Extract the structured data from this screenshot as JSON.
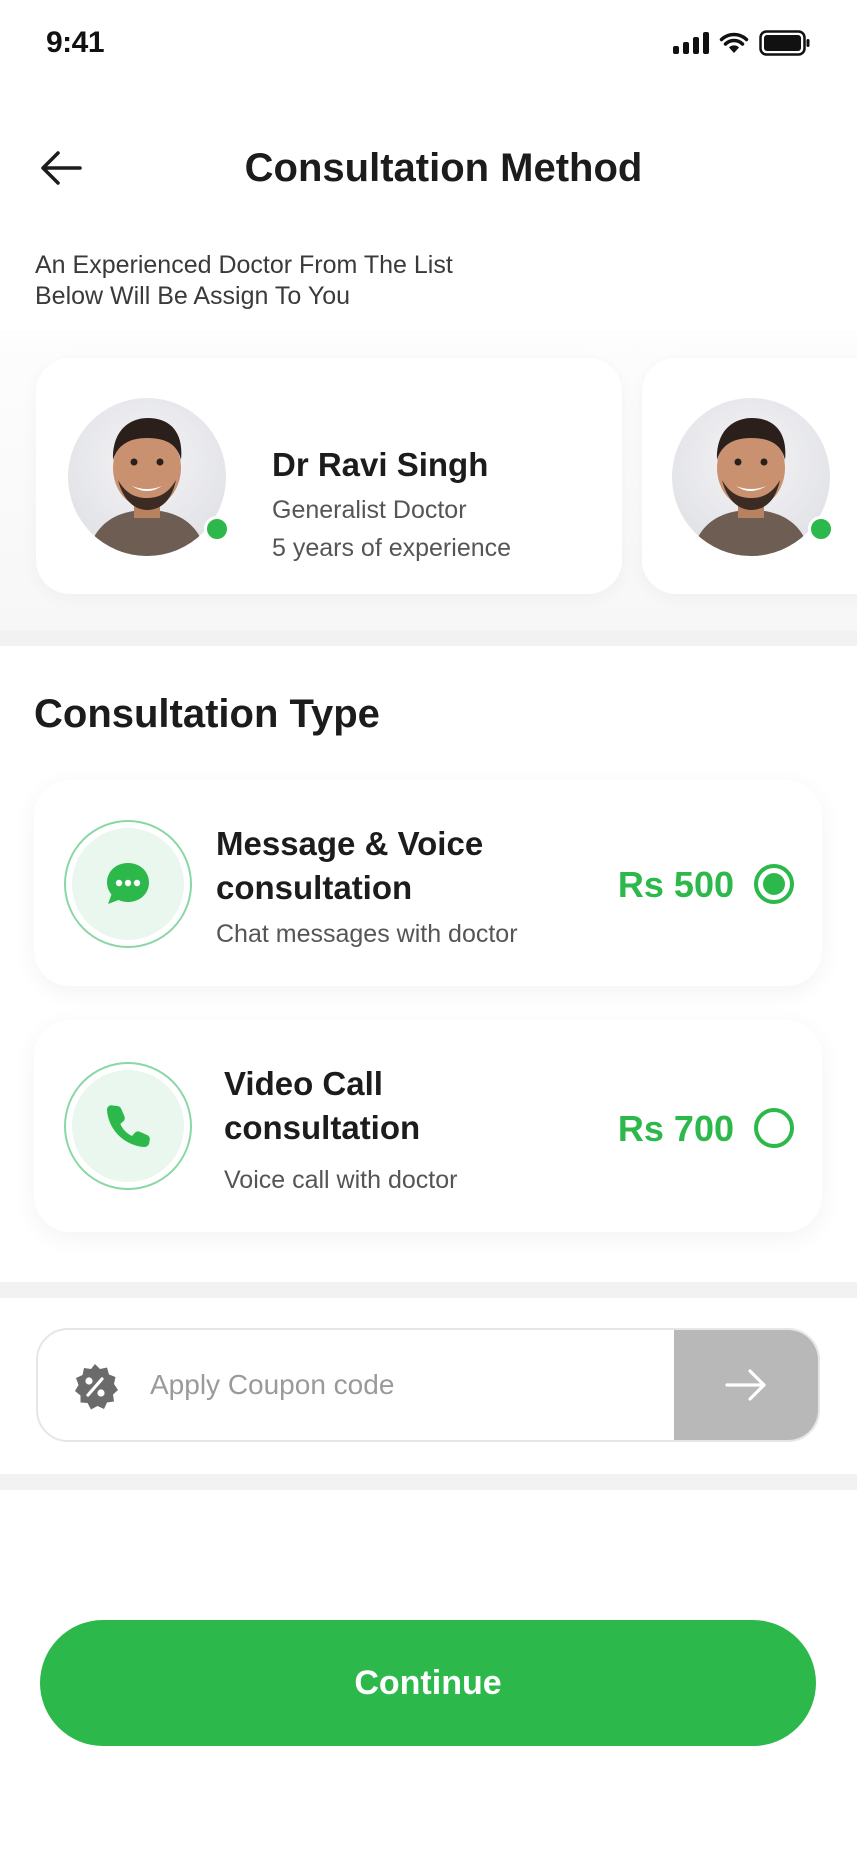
{
  "status_bar": {
    "time": "9:41"
  },
  "header": {
    "title": "Consultation Method"
  },
  "subtitle": "An Experienced Doctor From The List Below Will Be Assign To You",
  "doctors": [
    {
      "name": "Dr Ravi Singh",
      "specialty": "Generalist Doctor",
      "experience": "5 years of experience",
      "online": true
    },
    {
      "name": "",
      "specialty": "",
      "experience": "",
      "online": true
    }
  ],
  "consultation": {
    "section_title": "Consultation Type",
    "types": [
      {
        "title": "Message & Voice consultation",
        "description": "Chat messages with doctor",
        "price": "Rs 500",
        "icon": "chat-icon",
        "selected": true
      },
      {
        "title": "Video Call consultation",
        "description": "Voice call with doctor",
        "price": "Rs 700",
        "icon": "phone-icon",
        "selected": false
      }
    ]
  },
  "coupon": {
    "placeholder": "Apply Coupon code",
    "value": "",
    "icon": "discount-icon",
    "submit_icon": "arrow-right-icon"
  },
  "continue_label": "Continue",
  "colors": {
    "accent": "#2db84b",
    "accent_light": "#e9f7ee",
    "submit_disabled": "#b8b8b8"
  }
}
